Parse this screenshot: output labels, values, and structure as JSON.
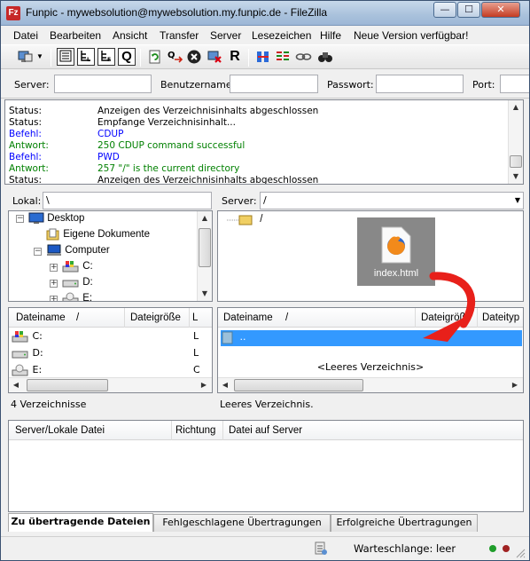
{
  "window": {
    "app_icon": "Fz",
    "title": "Funpic - mywebsolution@mywebsolution.my.funpic.de - FileZilla",
    "minimize_glyph": "—",
    "maximize_glyph": "☐",
    "close_glyph": "✕"
  },
  "menu": [
    "Datei",
    "Bearbeiten",
    "Ansicht",
    "Transfer",
    "Server",
    "Lesezeichen",
    "Hilfe",
    "Neue Version verfügbar!"
  ],
  "toolbar": {
    "icons": [
      "site-manager-icon",
      "dropdown-arrow-icon",
      "toggle-log-icon",
      "toggle-local-tree-icon",
      "toggle-remote-tree-icon",
      "toggle-queue-icon",
      "refresh-icon",
      "process-queue-icon",
      "cancel-icon",
      "disconnect-icon",
      "reconnect-icon",
      "directory-compare-icon",
      "filter-icon",
      "sync-browse-icon",
      "search-icon"
    ],
    "queue_glyph": "Q",
    "reconnect_glyph": "R"
  },
  "quickconnect": {
    "server_label": "Server:",
    "user_label": "Benutzername:",
    "password_label": "Passwort:",
    "port_label": "Port:",
    "server_value": "",
    "user_value": "",
    "password_value": "",
    "port_value": ""
  },
  "log": [
    {
      "type": "Status:",
      "msg": "Anzeigen des Verzeichnisinhalts abgeschlossen",
      "color": "#000000"
    },
    {
      "type": "Status:",
      "msg": "Empfange Verzeichnisinhalt...",
      "color": "#000000"
    },
    {
      "type": "Befehl:",
      "msg": "CDUP",
      "color": "#0000ff"
    },
    {
      "type": "Antwort:",
      "msg": "250 CDUP command successful",
      "color": "#008000"
    },
    {
      "type": "Befehl:",
      "msg": "PWD",
      "color": "#0000ff"
    },
    {
      "type": "Antwort:",
      "msg": "257 \"/\" is the current directory",
      "color": "#008000"
    },
    {
      "type": "Status:",
      "msg": "Anzeigen des Verzeichnisinhalts abgeschlossen",
      "color": "#000000"
    }
  ],
  "local": {
    "label": "Lokal:",
    "path": "\\",
    "tree": [
      {
        "label": "Desktop",
        "icon": "desktop-icon"
      },
      {
        "label": "Eigene Dokumente",
        "icon": "documents-folder-icon"
      },
      {
        "label": "Computer",
        "icon": "computer-icon"
      },
      {
        "label": "C:",
        "icon": "windows-drive-icon"
      },
      {
        "label": "D:",
        "icon": "drive-icon"
      },
      {
        "label": "E:",
        "icon": "cd-drive-icon"
      }
    ],
    "columns": [
      "Dateiname",
      "Dateigröße",
      "L"
    ],
    "files": [
      {
        "name": "C:",
        "icon": "windows-drive-icon",
        "tail": "L"
      },
      {
        "name": "D:",
        "icon": "drive-icon",
        "tail": "L"
      },
      {
        "name": "E:",
        "icon": "cd-drive-icon",
        "tail": "C"
      }
    ],
    "status": "4 Verzeichnisse"
  },
  "remote": {
    "label": "Server:",
    "path": "/",
    "tree": [
      {
        "label": "/",
        "icon": "folder-icon"
      }
    ],
    "columns": [
      "Dateiname",
      "Dateigröße",
      "Dateityp"
    ],
    "files": [
      {
        "name": "..",
        "icon": "folder-icon"
      }
    ],
    "empty_text": "<Leeres Verzeichnis>",
    "status": "Leeres Verzeichnis."
  },
  "sort_indicator": "/",
  "drag_overlay": {
    "label": "index.html",
    "icon": "firefox-html-file-icon",
    "arrow_color": "#e8201a"
  },
  "queue": {
    "columns": [
      "Server/Lokale Datei",
      "Richtung",
      "Datei auf Server"
    ]
  },
  "tabs": [
    "Zu übertragende Dateien",
    "Fehlgeschlagene Übertragungen",
    "Erfolgreiche Übertragungen"
  ],
  "statusbar": {
    "queue_text": "Warteschlange: leer",
    "led_colors": [
      "#1f9d2a",
      "#a02222"
    ]
  }
}
